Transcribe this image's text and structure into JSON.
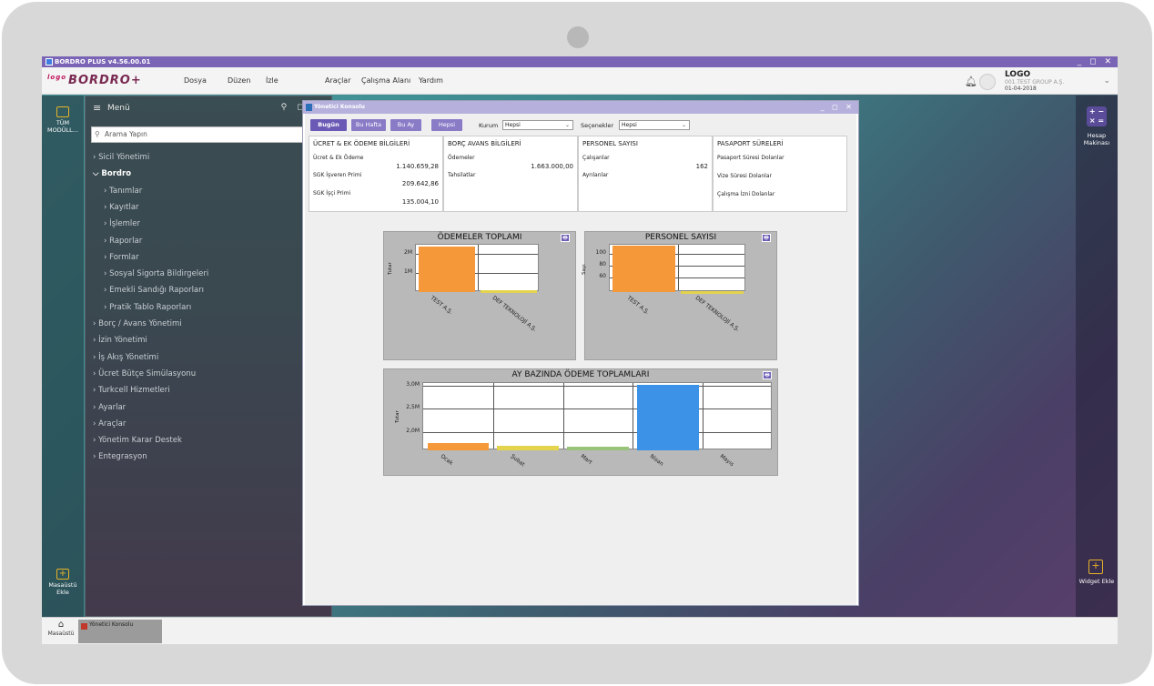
{
  "app": {
    "title": "BORDRO PLUS v4.56.00.01",
    "logo_small": "logo",
    "logo_main": "BORDRO+",
    "window_controls": "_ ◻ ✕"
  },
  "menubar": {
    "items": [
      "Dosya",
      "Düzen",
      "İzle",
      "Araçlar",
      "Çalışma Alanı",
      "Yardım"
    ]
  },
  "user": {
    "brand": "LOGO",
    "company": "001.TEST GROUP A.Ş.",
    "date": "01-04-2018"
  },
  "leftrail": {
    "modules_label": "TÜM MODÜLL...",
    "desktop_add_label": "Masaüstü Ekle"
  },
  "rightrail": {
    "calc_symbols": "+ −\n× =",
    "calc_label": "Hesap Makinası",
    "widget_label": "Widget Ekle"
  },
  "menu": {
    "title": "Menü",
    "header_controls": "⚲ ◻ ✕",
    "search_placeholder": "Arama Yapın",
    "items": [
      {
        "label": "Sicil Yönetimi",
        "level": 0,
        "expanded": false
      },
      {
        "label": "Bordro",
        "level": 0,
        "expanded": true
      },
      {
        "label": "Tanımlar",
        "level": 1,
        "expanded": false
      },
      {
        "label": "Kayıtlar",
        "level": 1,
        "expanded": false
      },
      {
        "label": "İşlemler",
        "level": 1,
        "expanded": false
      },
      {
        "label": "Raporlar",
        "level": 1,
        "expanded": false
      },
      {
        "label": "Formlar",
        "level": 1,
        "expanded": false
      },
      {
        "label": "Sosyal Sigorta Bildirgeleri",
        "level": 1,
        "expanded": false
      },
      {
        "label": "Emekli Sandığı Raporları",
        "level": 1,
        "expanded": false
      },
      {
        "label": "Pratik Tablo Raporları",
        "level": 1,
        "expanded": false
      },
      {
        "label": "Borç / Avans Yönetimi",
        "level": 0,
        "expanded": false
      },
      {
        "label": "İzin Yönetimi",
        "level": 0,
        "expanded": false
      },
      {
        "label": "İş Akış Yönetimi",
        "level": 0,
        "expanded": false
      },
      {
        "label": "Ücret Bütçe Simülasyonu",
        "level": 0,
        "expanded": false
      },
      {
        "label": "Turkcell Hizmetleri",
        "level": 0,
        "expanded": false
      },
      {
        "label": "Ayarlar",
        "level": 0,
        "expanded": false
      },
      {
        "label": "Araçlar",
        "level": 0,
        "expanded": false
      },
      {
        "label": "Yönetim Karar Destek",
        "level": 0,
        "expanded": false
      },
      {
        "label": "Entegrasyon",
        "level": 0,
        "expanded": false
      }
    ]
  },
  "taskbar": {
    "home_label": "Masaüstü",
    "task_label": "Yönetici Konsolu"
  },
  "console": {
    "title": "Yönetici Konsolu",
    "window_controls": "_ ◻ ✕",
    "filters": {
      "buttons": [
        "Bugün",
        "Bu Hafta",
        "Bu Ay",
        "Hepsi"
      ],
      "active": "Bugün",
      "kurum_label": "Kurum",
      "kurum_value": "Hepsi",
      "secenekler_label": "Seçenekler",
      "secenekler_value": "Hepsi"
    },
    "boxes": [
      {
        "title": "ÜCRET & EK ÖDEME BİLGİLERİ",
        "rows": [
          {
            "label": "Ücret & Ek Ödeme",
            "value": "1.140.659,28"
          },
          {
            "label": "SGK İşveren Primi",
            "value": "209.642,86"
          },
          {
            "label": "SGK İşçi Primi",
            "value": "135.004,10"
          }
        ]
      },
      {
        "title": "BORÇ AVANS BİLGİLERİ",
        "rows": [
          {
            "label": "Ödemeler",
            "value": "1.663.000,00"
          },
          {
            "label": "Tahsilatlar",
            "value": ""
          }
        ]
      },
      {
        "title": "PERSONEL SAYISI",
        "rows": [
          {
            "label": "Çalışanlar",
            "value": "162"
          },
          {
            "label": "Ayrılanlar",
            "value": ""
          }
        ]
      },
      {
        "title": "PASAPORT SÜRELERİ",
        "rows": [
          {
            "label": "Pasaport Süresi Dolanlar",
            "value": ""
          },
          {
            "label": "Vize Süresi Dolanlar",
            "value": ""
          },
          {
            "label": "Çalışma İzni Dolanlar",
            "value": ""
          }
        ]
      }
    ],
    "print_icon": "🖶"
  },
  "chart_data": [
    {
      "type": "bar",
      "title": "ÖDEMELER TOPLAMI",
      "ylabel": "Tutar",
      "categories": [
        "TEST A.Ş.",
        "DEF TEKNOLOJİ A.Ş."
      ],
      "values": [
        2400000,
        80000
      ],
      "colors": [
        "#f5983a",
        "#e3d34d"
      ],
      "yticks": [
        {
          "label": "2M",
          "value": 2000000
        },
        {
          "label": "1M",
          "value": 1000000
        }
      ],
      "ylim": [
        0,
        2500000
      ],
      "grid": true
    },
    {
      "type": "bar",
      "title": "PERSONEL SAYISI",
      "ylabel": "Sayı",
      "categories": [
        "TEST A.Ş.",
        "DEF TEKNOLOJİ A.Ş."
      ],
      "values": [
        113,
        37
      ],
      "colors": [
        "#f5983a",
        "#e3d34d"
      ],
      "yticks": [
        {
          "label": "100",
          "value": 100
        },
        {
          "label": "80",
          "value": 80
        },
        {
          "label": "60",
          "value": 60
        }
      ],
      "ylim": [
        35,
        115
      ],
      "grid": true
    },
    {
      "type": "bar",
      "title": "AY BAZINDA ÖDEME TOPLAMLARI",
      "ylabel": "Tutar",
      "categories": [
        "Ocak",
        "Şubat",
        "Mart",
        "Nisan",
        "Mayıs"
      ],
      "values": [
        1750000,
        1700000,
        1680000,
        3020000,
        0
      ],
      "colors": [
        "#f5983a",
        "#e3d34d",
        "#98c47a",
        "#3b92e6",
        "#cccccc"
      ],
      "yticks": [
        {
          "label": "3,0M",
          "value": 3000000
        },
        {
          "label": "2,5M",
          "value": 2500000
        },
        {
          "label": "2,0M",
          "value": 2000000
        }
      ],
      "ylim": [
        1600000,
        3050000
      ],
      "grid": true
    }
  ]
}
